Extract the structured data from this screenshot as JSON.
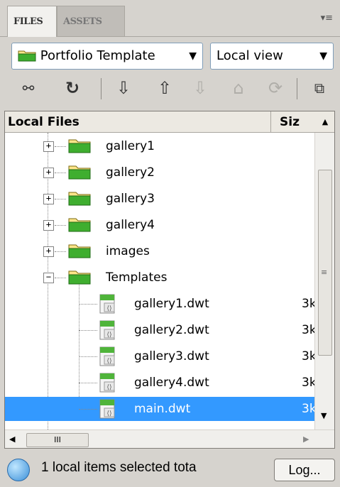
{
  "tabs": [
    {
      "label": "FILES"
    },
    {
      "label": "ASSETS"
    }
  ],
  "site_select": {
    "value": "Portfolio Template"
  },
  "view_select": {
    "value": "Local view"
  },
  "toolbar_icons": [
    "connect-icon",
    "refresh-icon",
    "get-files-icon",
    "put-files-icon",
    "check-out-icon",
    "check-in-icon",
    "synchronize-icon",
    "expand-icon"
  ],
  "columns": {
    "local_files": "Local Files",
    "size": "Siz"
  },
  "tree": [
    {
      "label": "gallery1",
      "type": "folder",
      "expander": "+",
      "size": ""
    },
    {
      "label": "gallery2",
      "type": "folder",
      "expander": "+",
      "size": ""
    },
    {
      "label": "gallery3",
      "type": "folder",
      "expander": "+",
      "size": ""
    },
    {
      "label": "gallery4",
      "type": "folder",
      "expander": "+",
      "size": ""
    },
    {
      "label": "images",
      "type": "folder",
      "expander": "+",
      "size": ""
    },
    {
      "label": "Templates",
      "type": "folder",
      "expander": "−",
      "size": ""
    },
    {
      "label": "gallery1.dwt",
      "type": "file",
      "size": "3k"
    },
    {
      "label": "gallery2.dwt",
      "type": "file",
      "size": "3k"
    },
    {
      "label": "gallery3.dwt",
      "type": "file",
      "size": "3k"
    },
    {
      "label": "gallery4.dwt",
      "type": "file",
      "size": "3k"
    },
    {
      "label": "main.dwt",
      "type": "file",
      "size": "3k",
      "selected": true
    }
  ],
  "hscroll_thumb": "III",
  "status": {
    "text": "1 local items selected tota",
    "log_button": "Log..."
  },
  "colors": {
    "selection": "#3399ff",
    "panel_bg": "#d6d3ce",
    "folder": "#3fae2f"
  }
}
